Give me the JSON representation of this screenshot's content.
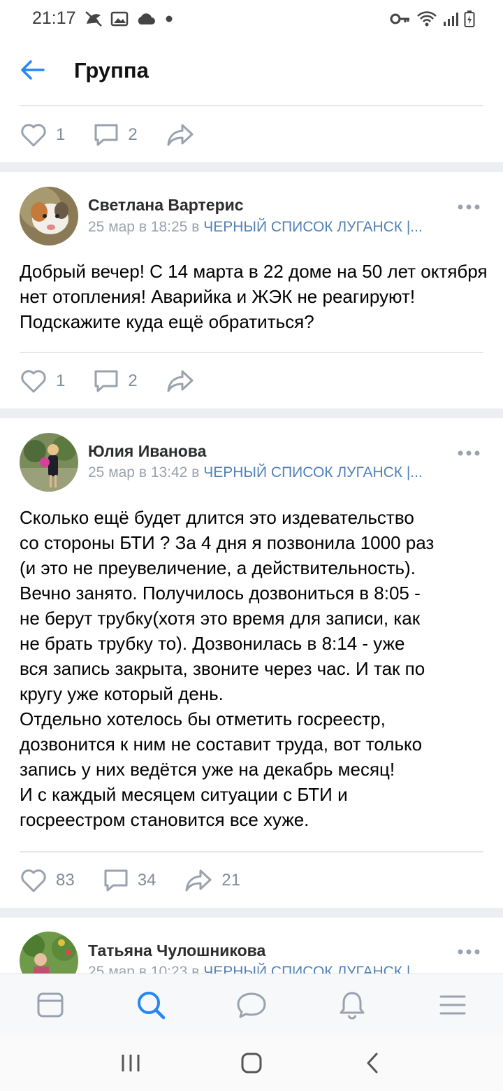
{
  "status": {
    "time": "21:17",
    "left_icons": [
      "no-disturb-icon",
      "image-icon",
      "cloud-icon",
      "dot-icon"
    ],
    "right_icons": [
      "key-icon",
      "wifi-icon",
      "signal-icon",
      "battery-icon"
    ]
  },
  "header": {
    "title": "Группа"
  },
  "posts": [
    {
      "likes": "1",
      "comments": "2",
      "shares": ""
    },
    {
      "author": "Светлана Вартерис",
      "time": "25 мар в 18:25 в ",
      "group": "ЧЕРНЫЙ СПИСОК ЛУГАНСК |...",
      "text": "Добрый вечер! С 14 марта в 22 доме на 50 лет октября нет отопления! Аварийка и ЖЭК не реагируют! Подскажите куда ещё обратиться?",
      "likes": "1",
      "comments": "2",
      "shares": ""
    },
    {
      "author": "Юлия Иванова",
      "time": "25 мар в 13:42 в ",
      "group": "ЧЕРНЫЙ СПИСОК ЛУГАНСК |...",
      "text_lines": [
        "Сколько ещё будет длится это издевательство",
        "со стороны БТИ ? За 4 дня я позвонила 1000 раз",
        "(и это не преувеличение, а действительность).",
        "Вечно занято. Получилось дозвониться в 8:05 -",
        "не берут трубку(хотя это время для записи, как",
        "не брать трубку то). Дозвонилась в 8:14 - уже",
        "вся запись закрыта, звоните через час. И так по",
        "кругу уже который день.",
        "Отдельно хотелось бы отметить госреестр,",
        "дозвонится к ним не составит труда, вот только",
        "запись у них ведётся уже на декабрь месяц!",
        "И с каждый месяцем ситуации с БТИ и",
        "госреестром становится все хуже."
      ],
      "likes": "83",
      "comments": "34",
      "shares": "21"
    },
    {
      "author": "Татьяна Чулошникова",
      "time": "25 мар в 10:23 в ",
      "group": "ЧЕРНЫЙ СПИСОК ЛУГАНСК |"
    }
  ],
  "tabbar": [
    "news-tab-icon",
    "search-tab-icon",
    "messages-tab-icon",
    "notifications-tab-icon",
    "menu-tab-icon"
  ],
  "colors": {
    "accent": "#2787f5",
    "link": "#5181b8",
    "icon_gray": "#99a2ad",
    "separator": "#eceef1"
  }
}
